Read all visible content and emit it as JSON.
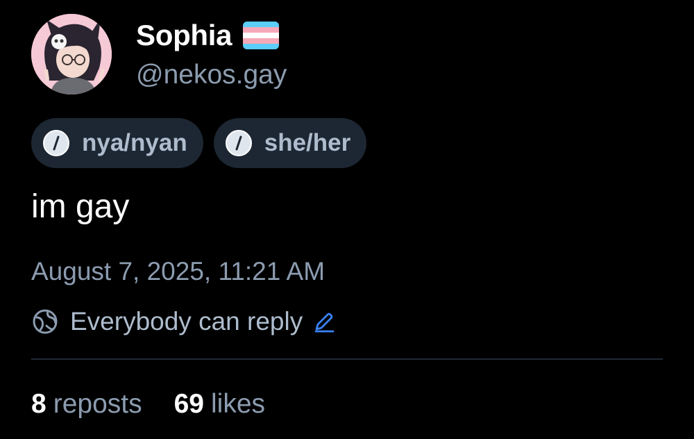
{
  "author": {
    "display_name": "Sophia",
    "handle": "@nekos.gay",
    "avatar": "avatar-image",
    "flag_icon": "transgender-flag",
    "flag_colors": [
      "#5bcefa",
      "#f5a9b8",
      "#ffffff",
      "#f5a9b8",
      "#5bcefa"
    ]
  },
  "pronouns": [
    {
      "label": "nya/nyan",
      "icon": "slash-circle-icon"
    },
    {
      "label": "she/her",
      "icon": "slash-circle-icon"
    }
  ],
  "post": {
    "text": "im gay",
    "timestamp": "August 7, 2025, 11:21 AM"
  },
  "reply_settings": {
    "label": "Everybody can reply",
    "icon": "globe-icon",
    "edit_icon": "pencil-icon"
  },
  "stats": {
    "reposts_count": "8",
    "reposts_label": "reposts",
    "likes_count": "69",
    "likes_label": "likes"
  },
  "colors": {
    "background": "#000000",
    "muted_text": "#8c9cb0",
    "pill_background": "#1d2733",
    "accent": "#3b82f6",
    "divider": "#1f2935"
  }
}
